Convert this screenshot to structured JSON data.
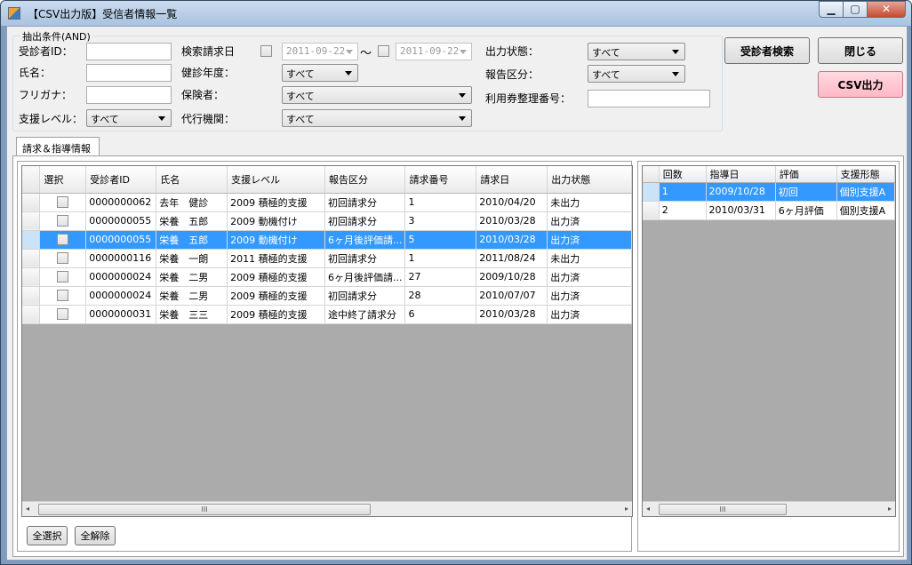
{
  "window": {
    "title": "【CSV出力版】受信者情報一覧",
    "min": "▁",
    "max": "▢",
    "close": "✕"
  },
  "filter": {
    "legend": "抽出条件(AND)",
    "patient_id_label": "受診者ID：",
    "patient_id_value": "",
    "name_label": "氏名：",
    "name_value": "",
    "kana_label": "フリガナ：",
    "kana_value": "",
    "support_level_label": "支援レベル：",
    "support_level_value": "すべて",
    "search_date_label": "検索請求日",
    "date_from": "2011-09-22",
    "tilde": "～",
    "date_to": "2011-09-22",
    "fiscal_year_label": "健診年度：",
    "fiscal_year_value": "すべて",
    "insurer_label": "保険者：",
    "insurer_value": "すべて",
    "agency_label": "代行機関：",
    "agency_value": "すべて",
    "output_state_label": "出力状態：",
    "output_state_value": "すべて",
    "report_type_label": "報告区分：",
    "report_type_value": "すべて",
    "voucher_label": "利用券整理番号：",
    "voucher_value": ""
  },
  "buttons": {
    "search": "受診者検索",
    "close": "閉じる",
    "csv": "CSV出力",
    "select_all": "全選択",
    "deselect_all": "全解除"
  },
  "tab": {
    "label": "請求＆指導情報"
  },
  "main_grid": {
    "columns": [
      "選択",
      "受診者ID",
      "氏名",
      "支援レベル",
      "報告区分",
      "請求番号",
      "請求日",
      "出力状態"
    ],
    "rows": [
      {
        "id": "0000000062",
        "name": "去年　健診",
        "level": "2009 積極的支援",
        "report": "初回請求分",
        "no": "1",
        "date": "2010/04/20",
        "state": "未出力"
      },
      {
        "id": "0000000055",
        "name": "栄養　五郎",
        "level": "2009 動機付け",
        "report": "初回請求分",
        "no": "3",
        "date": "2010/03/28",
        "state": "出力済"
      },
      {
        "id": "0000000055",
        "name": "栄養　五郎",
        "level": "2009 動機付け",
        "report": "6ヶ月後評価請...",
        "no": "5",
        "date": "2010/03/28",
        "state": "出力済"
      },
      {
        "id": "0000000116",
        "name": "栄養　一朗",
        "level": "2011 積極的支援",
        "report": "初回請求分",
        "no": "1",
        "date": "2011/08/24",
        "state": "未出力"
      },
      {
        "id": "0000000024",
        "name": "栄養　二男",
        "level": "2009 積極的支援",
        "report": "6ヶ月後評価請...",
        "no": "27",
        "date": "2009/10/28",
        "state": "出力済"
      },
      {
        "id": "0000000024",
        "name": "栄養　二男",
        "level": "2009 積極的支援",
        "report": "初回請求分",
        "no": "28",
        "date": "2010/07/07",
        "state": "出力済"
      },
      {
        "id": "0000000031",
        "name": "栄養　三三",
        "level": "2009 積極的支援",
        "report": "途中終了請求分",
        "no": "6",
        "date": "2010/03/28",
        "state": "出力済"
      }
    ]
  },
  "sub_grid": {
    "columns": [
      "回数",
      "指導日",
      "評価",
      "支援形態"
    ],
    "rows": [
      {
        "count": "1",
        "date": "2009/10/28",
        "eval": "初回",
        "form": "個別支援A"
      },
      {
        "count": "2",
        "date": "2010/03/31",
        "eval": "6ヶ月評価",
        "form": "個別支援A"
      }
    ]
  },
  "scrollbar": {
    "thumb": "III",
    "left": "◂",
    "right": "▸"
  },
  "colors": {
    "selection": "#3399ff",
    "csv_button": "#ffc0cb"
  }
}
